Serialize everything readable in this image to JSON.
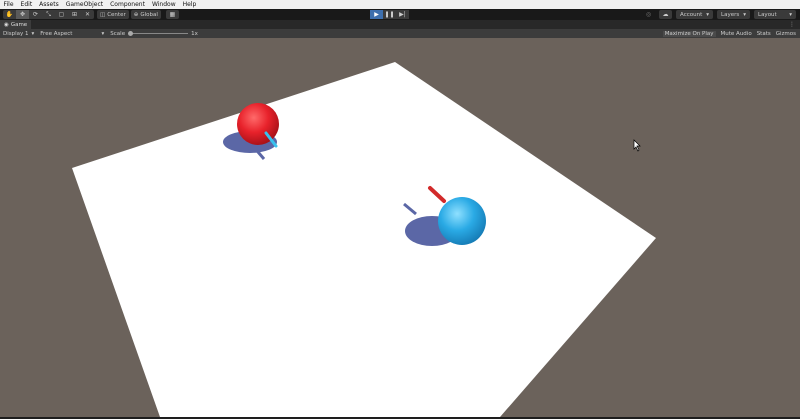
{
  "menu": [
    "File",
    "Edit",
    "Assets",
    "GameObject",
    "Component",
    "Window",
    "Help"
  ],
  "toolbar": {
    "pivot_label": "Center",
    "space_label": "Global",
    "account_label": "Account",
    "layers_label": "Layers",
    "layout_label": "Layout"
  },
  "tab": {
    "label": "Game"
  },
  "gamebar": {
    "display": "Display 1",
    "aspect": "Free Aspect",
    "scale_label": "Scale",
    "scale_value": "1x",
    "maximize": "Maximize On Play",
    "mute": "Mute Audio",
    "stats": "Stats",
    "gizmos": "Gizmos"
  },
  "scene": {
    "background": "#6b625b",
    "plane_color": "#ffffff",
    "red_ball_color": "#e8222b",
    "blue_ball_color": "#2aaae5"
  }
}
